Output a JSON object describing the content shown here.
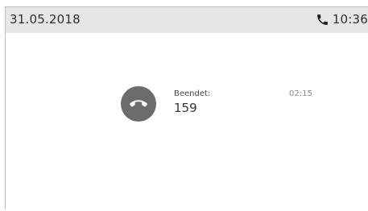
{
  "status_bar": {
    "date": "31.05.2018",
    "time": "10:36",
    "call_icon": "phone-icon"
  },
  "call": {
    "state_label": "Beendet:",
    "number": "159",
    "duration": "02:15",
    "action_icon": "hang-up-icon"
  },
  "colors": {
    "status_bar_bg": "#e6e6e6",
    "hangup_button": "#6c6c6c",
    "text_dark": "#2e2e2e",
    "text_muted": "#8a8a8a"
  }
}
